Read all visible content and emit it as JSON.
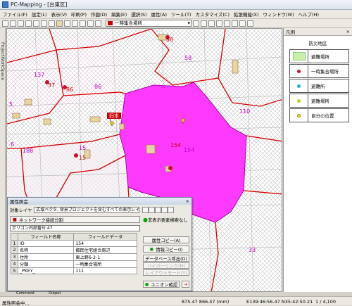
{
  "window": {
    "title": "PC-Mapping - [台東区]"
  },
  "menu": [
    "ファイル(F)",
    "設定(L)",
    "表示(V)",
    "印刷(P)",
    "作図(D)",
    "編集(E)",
    "選択(S)",
    "属性(A)",
    "ツール(T)",
    "カスタマイズ(C)",
    "拡張機能(X)",
    "ウィンドウ(W)",
    "ヘルプ(H)"
  ],
  "toolbar": {
    "layer_select": "一時集合場所"
  },
  "side_tab": "ProjectWorkSpace",
  "map_labels": {
    "l58": "58",
    "l58b": "58",
    "l137": "137",
    "l37": "37",
    "l86": "86",
    "l86b": "86",
    "l110": "110",
    "l154": "154",
    "l154b": "154",
    "l15": "15",
    "l15b": "15",
    "l6": "6",
    "l33": "33",
    "l188": "188",
    "l5": "5",
    "place": "旧本"
  },
  "legend": {
    "header": "凡例",
    "title": "防災地区",
    "items": [
      {
        "label": "避難場所",
        "color": "#c8f0a8"
      },
      {
        "label": "一時集合場所",
        "color": "#c8102e"
      },
      {
        "label": "避難所",
        "color": "#18b8c8"
      },
      {
        "label": "避難場所",
        "color": "#c8c820"
      },
      {
        "label": "自分の位置",
        "color": "#e8e030"
      }
    ]
  },
  "dialog": {
    "title": "属性照会",
    "target_label": "対象レイヤ",
    "target_value": "広域ベクタ, 背景プロジェクトを含むすべての表示レイヤ",
    "network_button": "ネットワーク接続分割",
    "nonshow_label": "非表示要素検索なし",
    "polygon_select": "ポリゴン内部番号 47",
    "columns": [
      "フィールド名称",
      "フィールドデータ"
    ],
    "rows": [
      [
        "1",
        "ID",
        "154"
      ],
      [
        "2",
        "名称",
        "都民住宅組合周辺"
      ],
      [
        "3",
        "住所",
        "東上野6-2-1"
      ],
      [
        "4",
        "分類",
        "一時集合場所"
      ],
      [
        "5",
        "_PKEY_",
        "111"
      ]
    ],
    "buttons": {
      "copy": "属性コピー(A)",
      "info_copy": "情報コピー(I)",
      "db_out": "データベース呼出(D)",
      "btn4": "ハイパーリンク(H)",
      "btn5": "レイアウトモード(Y)",
      "union": "ユニオン確認"
    }
  },
  "bottom_tabs": [
    "Command",
    "Output"
  ],
  "status": {
    "left": "属性照会中...",
    "coords": "875.47 866.47 (mm)",
    "latlon": "E139:46:56.47 N35:42:50.21",
    "scale": "1 / 4,100"
  }
}
